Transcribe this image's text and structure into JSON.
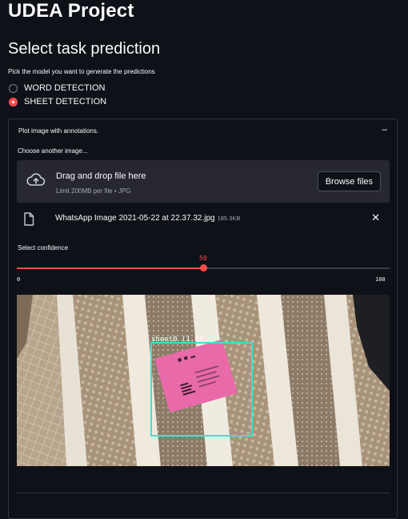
{
  "header": {
    "title": "UDEA Project"
  },
  "task": {
    "heading": "Select task prediction",
    "hint": "Pick the model you want to generate the predictions",
    "options": [
      {
        "label": "WORD DETECTION",
        "selected": false
      },
      {
        "label": "SHEET DETECTION",
        "selected": true
      }
    ]
  },
  "expander": {
    "title": "Plot image with annotations.",
    "toggle": "–",
    "uploader_label": "Choose another image...",
    "dropzone": {
      "title": "Drag and drop file here",
      "subtitle": "Limit 200MB per file • JPG",
      "browse_label": "Browse files",
      "icon": "cloud-upload-icon"
    },
    "file": {
      "name": "WhatsApp Image 2021-05-22 at 22.37.32.jpg",
      "size": "185.3KB",
      "icon": "file-icon",
      "remove_icon": "close-icon"
    },
    "slider": {
      "label": "Select confidence",
      "value": 50,
      "min": 0,
      "max": 100,
      "min_label": "0",
      "max_label": "100",
      "value_label": "50"
    },
    "image": {
      "annotation_label": "sheet0 (1.0)"
    }
  },
  "colors": {
    "background": "#0e1117",
    "accent": "#ff4b4b",
    "surface": "#262730",
    "box": "#40e0d0",
    "sheet": "#e86aa8"
  }
}
